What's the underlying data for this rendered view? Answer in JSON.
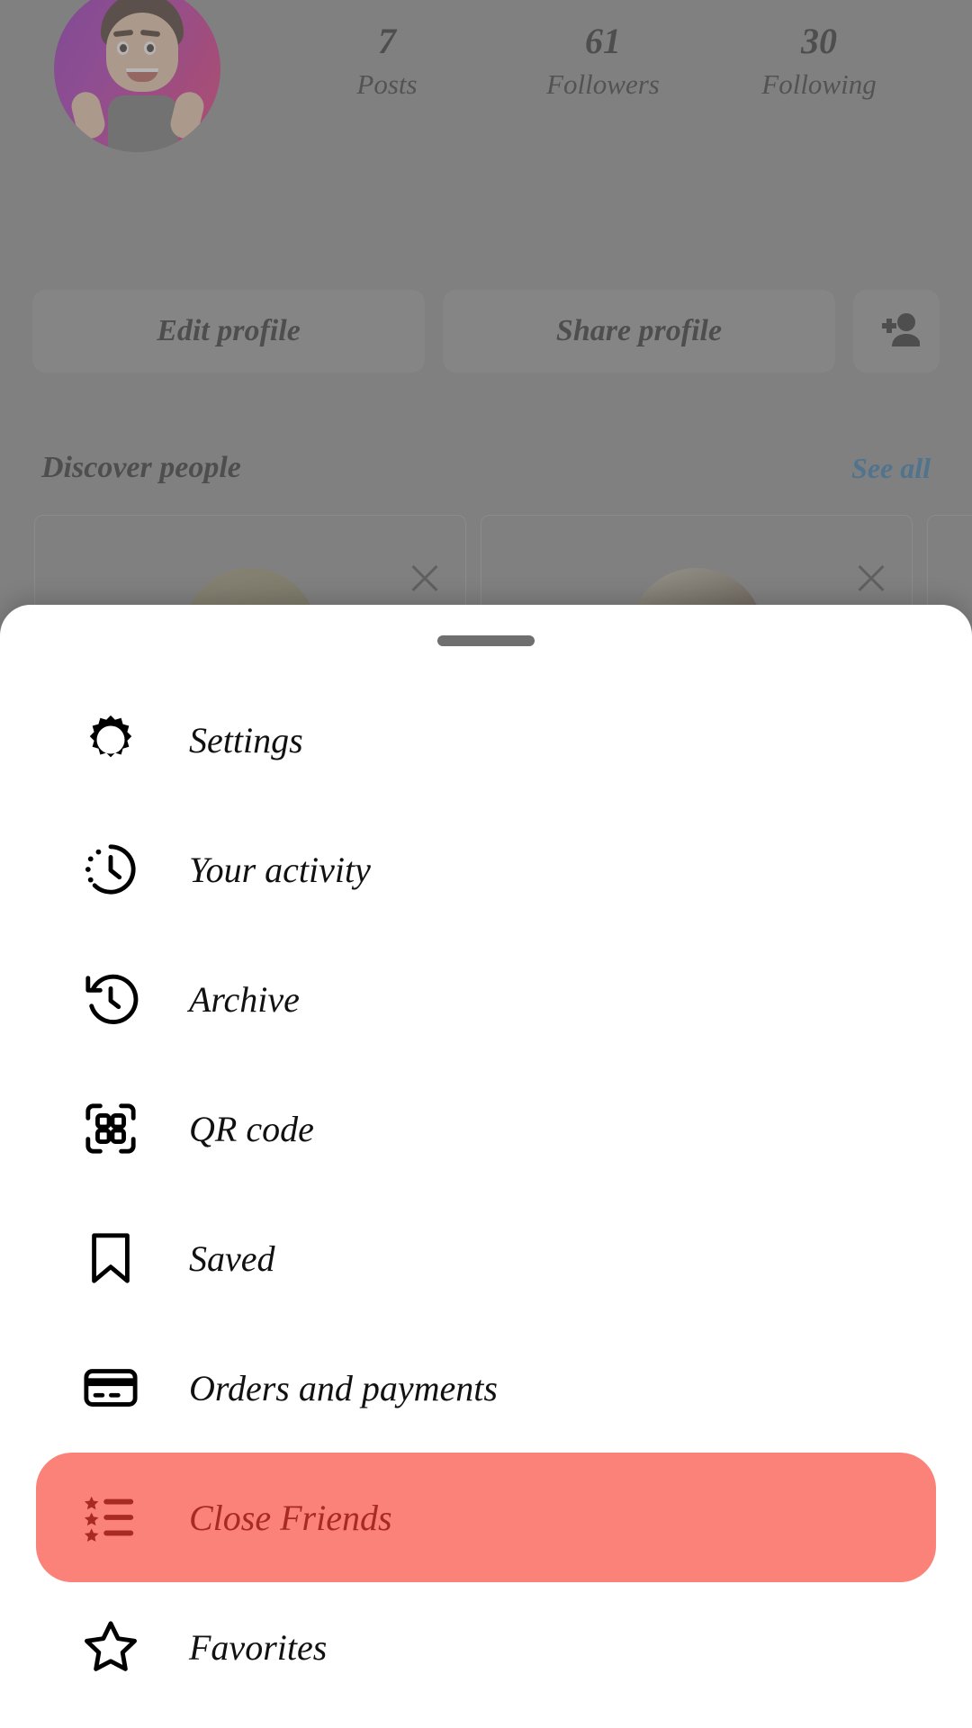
{
  "profile": {
    "avatar_name": "profile-avatar",
    "stats": [
      {
        "value": "7",
        "label": "Posts"
      },
      {
        "value": "61",
        "label": "Followers"
      },
      {
        "value": "30",
        "label": "Following"
      }
    ],
    "actions": {
      "edit_profile": "Edit profile",
      "share_profile": "Share profile",
      "add_person_icon": "add-person-icon"
    },
    "discover": {
      "title": "Discover people",
      "see_all": "See all",
      "see_all_color": "#1f6fa8"
    }
  },
  "sheet": {
    "handle": "drag-handle",
    "highlight_bg": "#fa8279",
    "highlight_fg": "#a82a22",
    "items": [
      {
        "label": "Settings",
        "icon": "gear-icon",
        "highlighted": false
      },
      {
        "label": "Your activity",
        "icon": "activity-clock-icon",
        "highlighted": false
      },
      {
        "label": "Archive",
        "icon": "archive-clock-icon",
        "highlighted": false
      },
      {
        "label": "QR code",
        "icon": "qr-code-icon",
        "highlighted": false
      },
      {
        "label": "Saved",
        "icon": "bookmark-icon",
        "highlighted": false
      },
      {
        "label": "Orders and payments",
        "icon": "credit-card-icon",
        "highlighted": false
      },
      {
        "label": "Close Friends",
        "icon": "star-list-icon",
        "highlighted": true
      },
      {
        "label": "Favorites",
        "icon": "star-outline-icon",
        "highlighted": false
      }
    ]
  }
}
